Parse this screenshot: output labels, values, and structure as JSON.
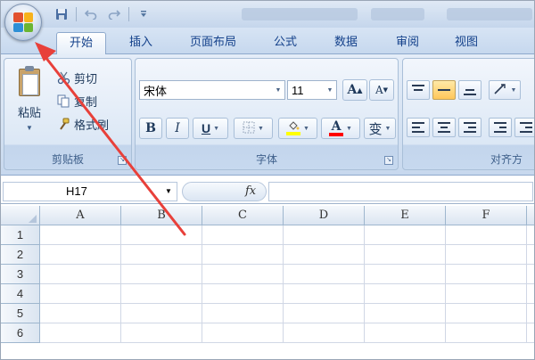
{
  "title_bar": {
    "quick_access": [
      "save-icon",
      "undo-icon",
      "redo-icon",
      "customize-icon"
    ]
  },
  "office_button": {
    "icon": "office-logo-icon"
  },
  "tabs": [
    {
      "label": "开始",
      "active": true
    },
    {
      "label": "插入"
    },
    {
      "label": "页面布局"
    },
    {
      "label": "公式"
    },
    {
      "label": "数据"
    },
    {
      "label": "审阅"
    },
    {
      "label": "视图"
    }
  ],
  "clipboard": {
    "label": "剪贴板",
    "paste_label": "粘贴",
    "cut_label": "剪切",
    "copy_label": "复制",
    "format_painter_label": "格式刷"
  },
  "font": {
    "label": "字体",
    "font_name": "宋体",
    "font_size": "11",
    "bold": "B",
    "italic": "I",
    "underline": "U",
    "font_color_letter": "A",
    "phonetic": "变",
    "grow_font": "A",
    "shrink_font": "A"
  },
  "alignment": {
    "label": "对齐方"
  },
  "formula_bar": {
    "name_box": "H17",
    "fx_label": "fx",
    "formula_value": ""
  },
  "grid": {
    "columns": [
      "A",
      "B",
      "C",
      "D",
      "E",
      "F"
    ],
    "rows": [
      "1",
      "2",
      "3",
      "4",
      "5",
      "6"
    ]
  },
  "colors": {
    "annotation_arrow": "#e8403a",
    "ribbon_bg": "#dbe7f5",
    "highlight_button": "#ffc75a",
    "font_color_bar": "#ff0000",
    "fill_color_bar": "#ffff00"
  }
}
